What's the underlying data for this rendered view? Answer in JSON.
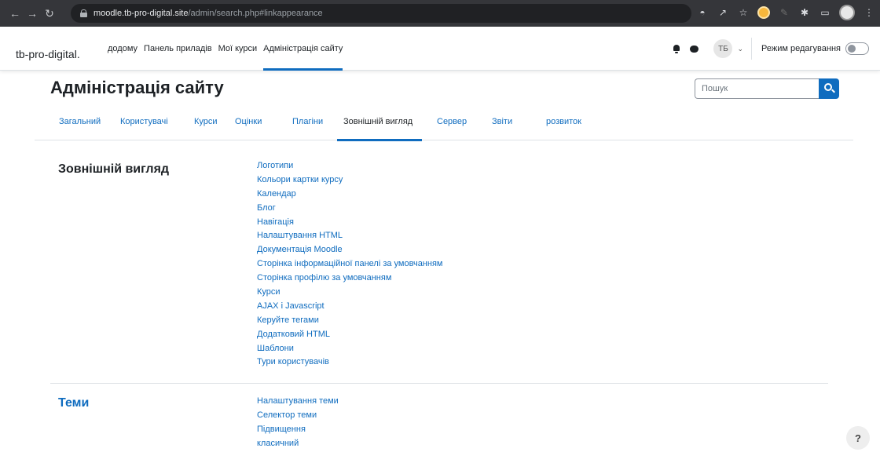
{
  "browser": {
    "url_host": "moodle.tb-pro-digital.site",
    "url_path": "/admin/search.php#linkappearance",
    "icons": [
      "back-icon",
      "forward-icon",
      "reload-icon",
      "lock-icon",
      "translate-icon",
      "share-icon",
      "star-icon",
      "extension-icon",
      "pen-icon",
      "puzzle-icon",
      "sidepanel-icon",
      "profile-icon",
      "menu-icon"
    ]
  },
  "navbar": {
    "brand": "tb-pro-digital.",
    "items": [
      {
        "label": "додому",
        "active": false
      },
      {
        "label": "Панель приладів",
        "active": false
      },
      {
        "label": "Мої курси",
        "active": false
      },
      {
        "label": "Адміністрація сайту",
        "active": true
      }
    ],
    "user_initials": "ТБ",
    "edit_mode_label": "Режим редагування",
    "edit_mode_on": false
  },
  "page": {
    "title": "Адміністрація сайту",
    "search_placeholder": "Пошук"
  },
  "tabs": [
    {
      "label": "Загальний",
      "active": false
    },
    {
      "label": "Користувачі",
      "active": false
    },
    {
      "label": "Курси",
      "active": false
    },
    {
      "label": "Оцінки",
      "active": false
    },
    {
      "label": "Плагіни",
      "active": false
    },
    {
      "label": "Зовнішній вигляд",
      "active": true
    },
    {
      "label": "Сервер",
      "active": false
    },
    {
      "label": "Звіти",
      "active": false
    },
    {
      "label": "розвиток",
      "active": false
    }
  ],
  "sections": [
    {
      "heading": "Зовнішній вигляд",
      "links": [
        "Логотипи",
        "Кольори картки курсу",
        "Календар",
        "Блог",
        "Навігація",
        "Налаштування HTML",
        "Документація Moodle",
        "Сторінка інформаційної панелі за умовчанням",
        "Сторінка профілю за умовчанням",
        "Курси",
        "AJAX і Javascript",
        "Керуйте тегами",
        "Додатковий HTML",
        "Шаблони",
        "Тури користувачів"
      ]
    },
    {
      "heading": "Теми",
      "links": [
        "Налаштування теми",
        "Селектор теми",
        "Підвищення",
        "класичний"
      ]
    }
  ],
  "help_label": "?",
  "colors": {
    "accent": "#0f6cbf",
    "text": "#1d2125",
    "browser_chrome": "#35363a"
  }
}
